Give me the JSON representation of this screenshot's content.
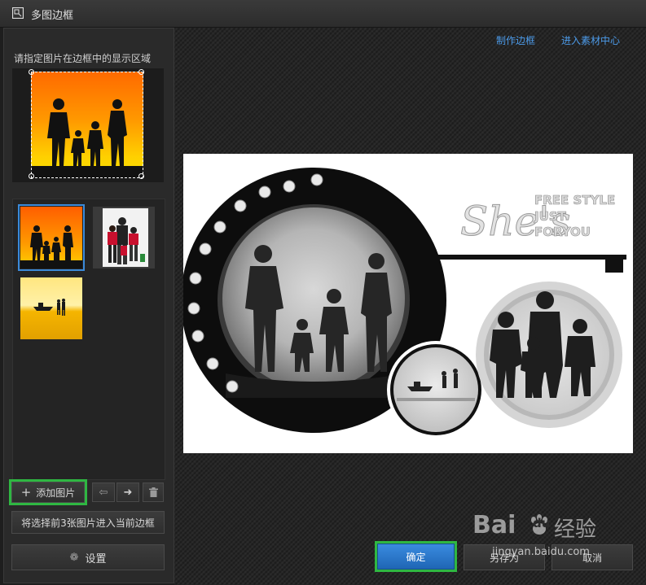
{
  "window": {
    "title": "多图边框"
  },
  "left_panel": {
    "hint": "请指定图片在边框中的显示区域",
    "add_button_label": "添加图片",
    "info_text": "将选择前3张图片进入当前边框",
    "settings_label": "设置"
  },
  "main": {
    "links": {
      "make_frame": "制作边框",
      "enter_material_center": "进入素材中心"
    },
    "frame_text": {
      "script": "She's",
      "line1": "FREE STYLE",
      "line2": "JUST",
      "line3": "FORYOU"
    }
  },
  "footer": {
    "confirm_label": "确定",
    "save_as_label": "另存为",
    "cancel_label": "取消"
  },
  "watermark": {
    "brand": "Bai",
    "brand2": "du",
    "brand_cn": "经验",
    "url": "jingyan.baidu.com"
  },
  "colors": {
    "link": "#4c9bea",
    "selection": "#3b8ad9",
    "highlight": "#2fb742",
    "primary_button": "#2a78c8"
  },
  "icons": [
    "frame-app-icon",
    "plus-icon",
    "arrow-left-icon",
    "arrow-right-icon",
    "trash-icon",
    "gear-icon"
  ]
}
